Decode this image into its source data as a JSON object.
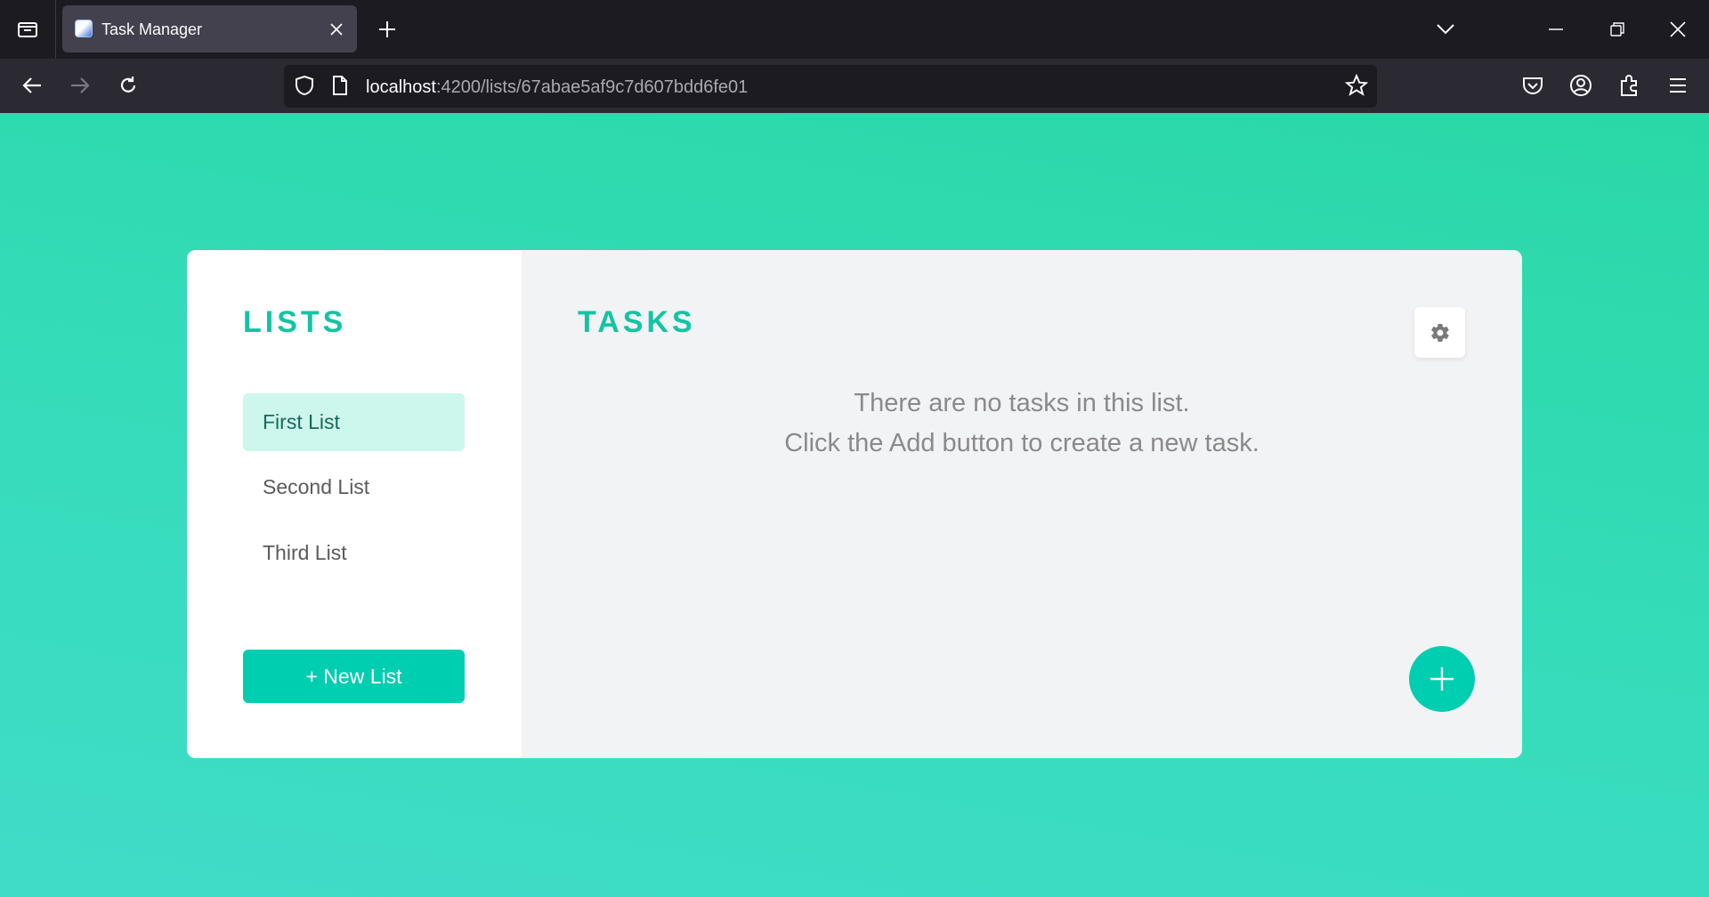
{
  "browser": {
    "tab_title": "Task Manager",
    "url_host": "localhost",
    "url_rest": ":4200/lists/67abae5af9c7d607bdd6fe01"
  },
  "icons": {
    "tab_list": "tab-list-icon",
    "favicon": "app-favicon-icon",
    "tab_close": "close-icon",
    "new_tab": "plus-icon",
    "list_all_tabs": "chevron-down-icon",
    "minimize": "minimize-icon",
    "restore": "restore-icon",
    "close_window": "close-icon",
    "back": "arrow-left-icon",
    "forward": "arrow-right-icon",
    "reload": "reload-icon",
    "shield": "shield-icon",
    "page": "page-icon",
    "bookmark": "star-icon",
    "pocket": "pocket-icon",
    "account": "account-icon",
    "extensions": "puzzle-icon",
    "menu": "hamburger-menu-icon",
    "settings": "gear-icon",
    "add_task": "plus-icon"
  },
  "sidebar": {
    "title": "LISTS",
    "items": [
      {
        "label": "First List",
        "active": true
      },
      {
        "label": "Second List",
        "active": false
      },
      {
        "label": "Third List",
        "active": false
      }
    ],
    "new_list_label": "+ New List"
  },
  "main": {
    "title": "TASKS",
    "empty_line1": "There are no tasks in this list.",
    "empty_line2": "Click the Add button to create a new task."
  },
  "colors": {
    "accent": "#00ceb0",
    "title": "#12c4a4",
    "active_item_bg": "#cdf6ec",
    "page_gradient_top": "#2ad8a6",
    "page_gradient_bottom": "#40dcc8"
  }
}
